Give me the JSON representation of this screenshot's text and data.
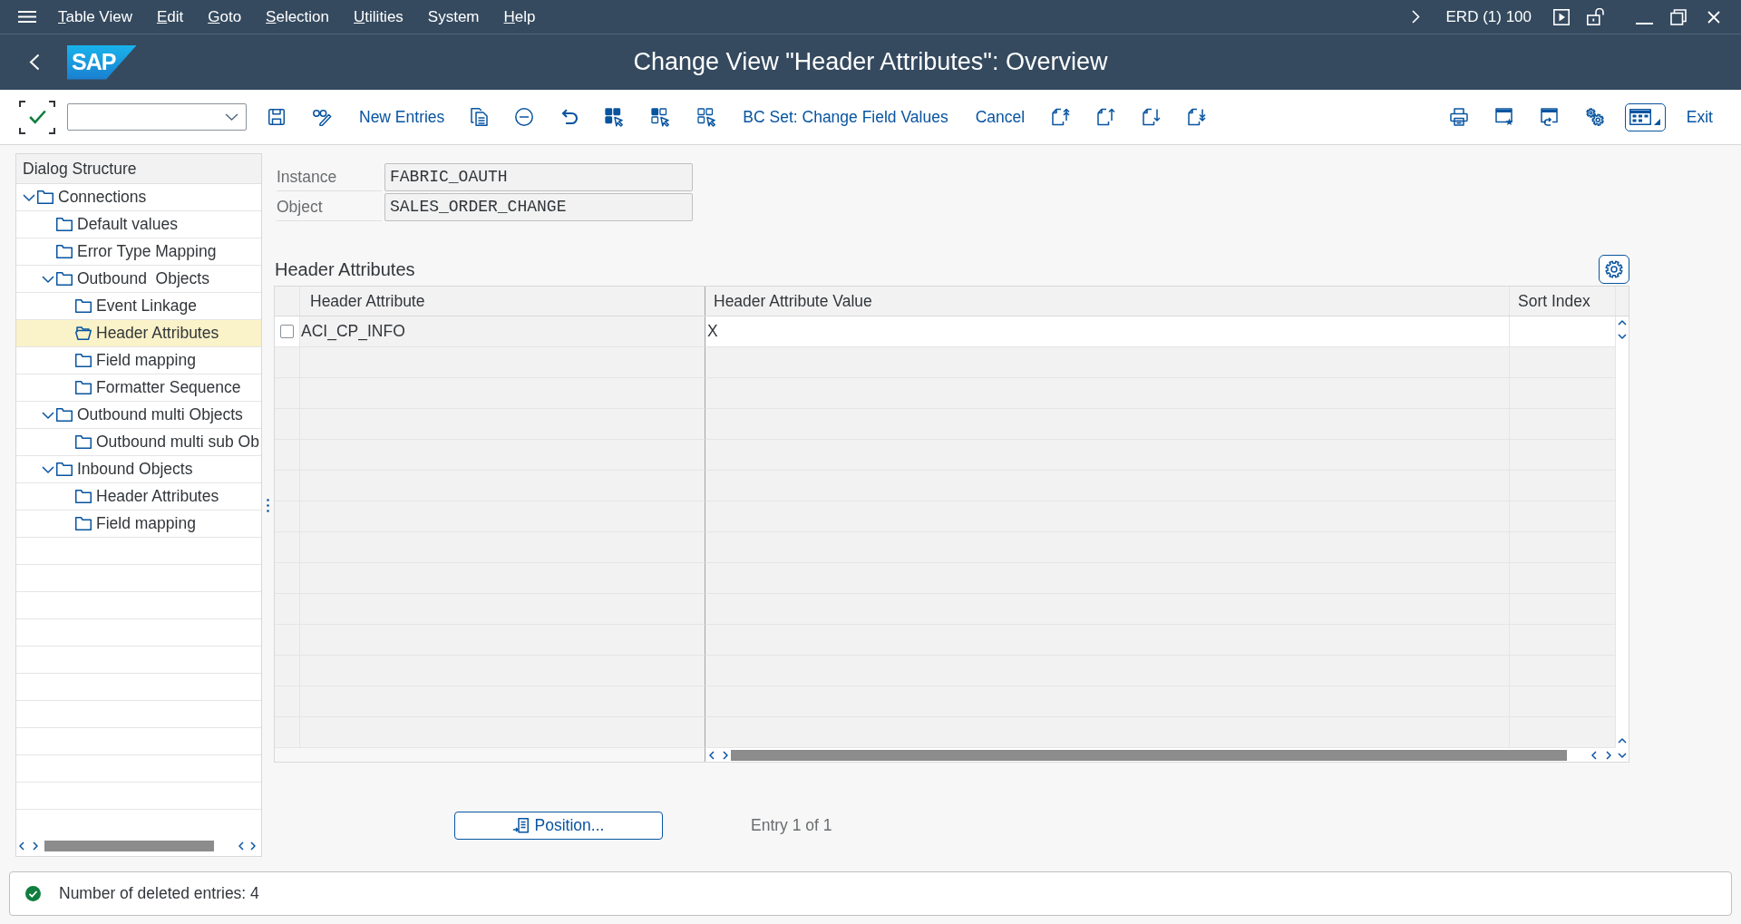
{
  "menu_bar": {
    "items": [
      {
        "label": "Table View",
        "mnemonic": true
      },
      {
        "label": "Edit",
        "mnemonic": true
      },
      {
        "label": "Goto",
        "mnemonic": true
      },
      {
        "label": "Selection",
        "mnemonic": true
      },
      {
        "label": "Utilities",
        "mnemonic": true
      },
      {
        "label": "System",
        "mnemonic": false
      },
      {
        "label": "Help",
        "mnemonic": true
      }
    ],
    "system_info": "ERD (1) 100"
  },
  "title_bar": {
    "logo": "SAP",
    "title": "Change View \"Header Attributes\": Overview"
  },
  "toolbar": {
    "new_entries": "New Entries",
    "bc_set": "BC Set: Change Field Values",
    "cancel": "Cancel",
    "exit": "Exit"
  },
  "dialog_structure": {
    "title": "Dialog Structure",
    "items": [
      {
        "label": "Connections",
        "expanded": true,
        "selected": false,
        "children": [
          {
            "label": "Default values",
            "selected": false
          },
          {
            "label": "Error Type Mapping",
            "selected": false
          },
          {
            "label": "Outbound  Objects",
            "expanded": true,
            "selected": false,
            "children": [
              {
                "label": "Event Linkage",
                "selected": false
              },
              {
                "label": "Header Attributes",
                "selected": true
              },
              {
                "label": "Field mapping",
                "selected": false
              },
              {
                "label": "Formatter Sequence",
                "selected": false
              }
            ]
          },
          {
            "label": "Outbound multi Objects",
            "expanded": true,
            "selected": false,
            "children": [
              {
                "label": "Outbound multi sub Ob",
                "selected": false
              }
            ]
          },
          {
            "label": "Inbound Objects",
            "expanded": true,
            "selected": false,
            "children": [
              {
                "label": "Header Attributes",
                "selected": false
              },
              {
                "label": "Field mapping",
                "selected": false
              }
            ]
          }
        ]
      }
    ]
  },
  "header_fields": [
    {
      "label": "Instance",
      "value": "FABRIC_OAUTH"
    },
    {
      "label": "Object",
      "value": "SALES_ORDER_CHANGE"
    }
  ],
  "table": {
    "title": "Header Attributes",
    "columns": [
      "Header Attribute",
      "Header Attribute Value",
      "Sort Index"
    ],
    "rows": [
      {
        "selected": false,
        "header_attribute": "ACI_CP_INFO",
        "header_attribute_value": "X"
      }
    ]
  },
  "position_button": "Position...",
  "entry_info": "Entry 1 of 1",
  "status_bar": {
    "kind": "success",
    "message": "Number of deleted entries: 4"
  }
}
